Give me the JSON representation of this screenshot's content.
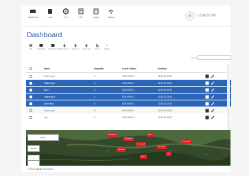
{
  "nav": [
    {
      "label": "Dashboard",
      "icon": "dashboard-icon"
    },
    {
      "label": "Units",
      "icon": "units-icon"
    },
    {
      "label": "POI",
      "icon": "poi-icon"
    },
    {
      "label": "IBS",
      "icon": "ibs-icon"
    },
    {
      "label": "Details",
      "icon": "details-icon"
    },
    {
      "label": "Settings",
      "icon": "settings-icon"
    }
  ],
  "logo_text": "LOGISTIK",
  "page_title": "Dashboard",
  "toolbar": [
    {
      "label": "Alle",
      "icon": "select-all-icon"
    },
    {
      "label": "Auswählen",
      "icon": "select-icon"
    },
    {
      "label": "Ausnahme (IQ)",
      "icon": "exception-icon"
    },
    {
      "label": "Ausnahme ...",
      "icon": "exception2-icon"
    },
    {
      "label": "Status (1)",
      "icon": "status1-icon"
    },
    {
      "label": "Status (2)",
      "icon": "status2-icon"
    },
    {
      "label": "Status",
      "icon": "status-icon"
    },
    {
      "label": "Details",
      "icon": "details-tool-icon"
    }
  ],
  "search_label": "Suche",
  "table": {
    "headers": [
      "Name",
      "Ungefähr",
      "Letzte Aktion",
      "Position"
    ],
    "rows": [
      {
        "name": "Fahrzeug 1",
        "v": "0",
        "last": "0:00:00:00 1",
        "pos": "12.05.23 11:00",
        "selected": false
      },
      {
        "name": "Fahrzeug 2",
        "v": "0",
        "last": "0:00:00:00 1",
        "pos": "12.05.23 11:00",
        "selected": true
      },
      {
        "name": "Bus 1",
        "v": "0",
        "last": "0:00:00:00 1",
        "pos": "12.05.23 11:00",
        "selected": true
      },
      {
        "name": "Fahrzeug 3",
        "v": "1",
        "last": "0:00:00:00 1",
        "pos": "12.05.23 11:00",
        "selected": true
      },
      {
        "name": "Lkw West",
        "v": "0",
        "last": "0:00:00:00 1",
        "pos": "12.05.23 11:00",
        "selected": true
      },
      {
        "name": "Fahrzeug 4",
        "v": "0",
        "last": "0:00:00:00 1",
        "pos": "12.05.23 11:00",
        "selected": false
      },
      {
        "name": "Lkw",
        "v": "0",
        "last": "0:00:00:00 1",
        "pos": "12.05.23 11:00",
        "selected": false
      }
    ]
  },
  "map": {
    "pins": [
      "Fahrzeug 1",
      "Fahrzeug 2",
      "Bus 1",
      "Fahrzeug 3",
      "Lkw West",
      "Fahrzeug 4",
      "Lkw",
      "Bus 2",
      "Fahrzeug 5"
    ],
    "controls": [
      "Karte",
      "Satellit",
      "+",
      "-"
    ]
  },
  "footer": {
    "prefix": "© 2023 Logistik",
    "link": "Impressum"
  },
  "colors": {
    "accent": "#2b65b8",
    "title": "#2d5aa6",
    "pin": "#e01f26"
  }
}
